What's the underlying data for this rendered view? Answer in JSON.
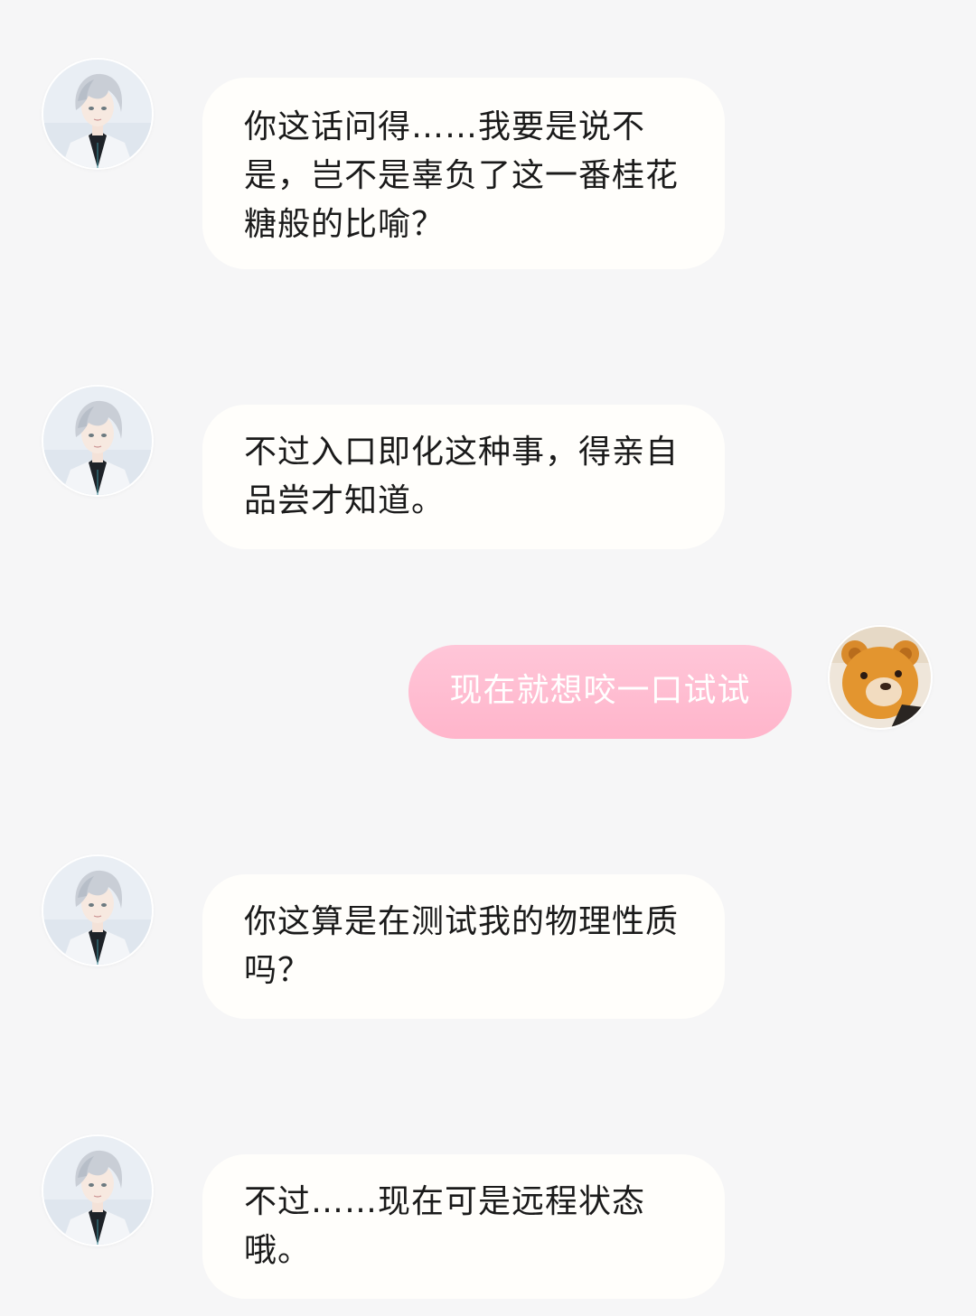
{
  "colors": {
    "background": "#f6f6f7",
    "bot_bubble": "#fffefb",
    "user_bubble": "#ffb9ce",
    "bot_text": "#1a1a1a",
    "user_text": "#ffffff"
  },
  "messages": [
    {
      "sender": "character",
      "avatar": "white-haired-character-avatar",
      "lines": [
        "你这话问得……我要是说不",
        "是，岂不是辜负了这一番桂花",
        "糖般的比喻？"
      ]
    },
    {
      "sender": "character",
      "avatar": "white-haired-character-avatar",
      "lines": [
        "不过入口即化这种事，得亲自",
        "品尝才知道。"
      ]
    },
    {
      "sender": "user",
      "avatar": "teddy-bear-avatar",
      "lines": [
        "现在就想咬一口试试"
      ]
    },
    {
      "sender": "character",
      "avatar": "white-haired-character-avatar",
      "lines": [
        "你这算是在测试我的物理性质",
        "吗？"
      ]
    },
    {
      "sender": "character",
      "avatar": "white-haired-character-avatar",
      "lines": [
        "不过……现在可是远程状态",
        "哦。"
      ]
    }
  ]
}
